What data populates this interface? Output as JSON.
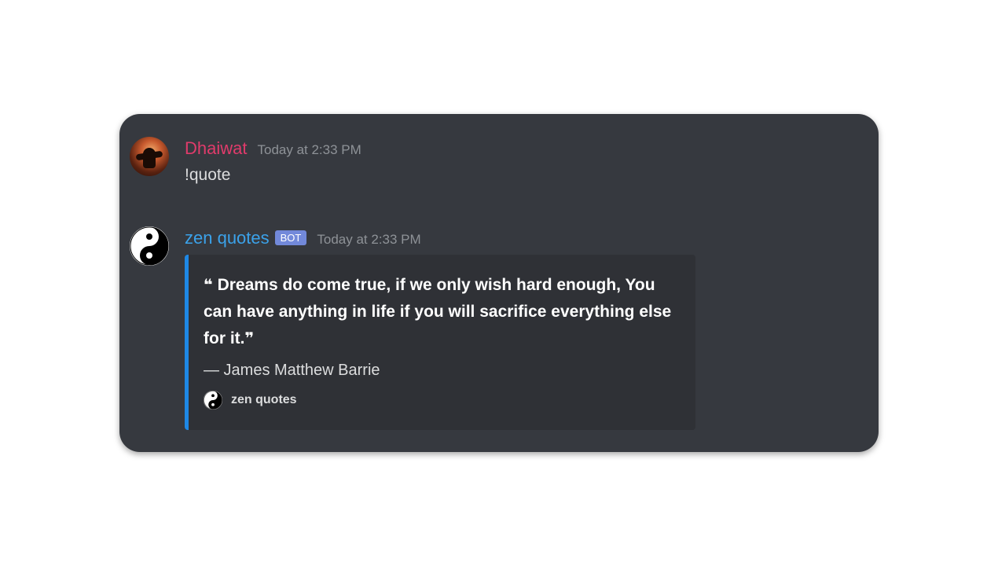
{
  "messages": [
    {
      "author": "Dhaiwat",
      "timestamp": "Today at 2:33 PM",
      "text": "!quote",
      "avatar_icon": "user-avatar",
      "name_color": "#e03b6b"
    },
    {
      "author": "zen quotes",
      "badge": "BOT",
      "timestamp": "Today at 2:33 PM",
      "avatar_icon": "yin-yang-icon",
      "name_color": "#3ba2ea",
      "embed": {
        "open_quote": "❝",
        "quote": "Dreams do come true, if we only wish hard enough, You can have anything in life if you will sacrifice everything else for it.",
        "close_quote": "❞",
        "author_line": "— James Matthew Barrie",
        "footer_icon": "yin-yang-icon",
        "footer_text": "zen quotes",
        "accent_color": "#1e88e5"
      }
    }
  ],
  "colors": {
    "card_background": "#36393f",
    "embed_background": "#2f3136",
    "badge_background": "#7289da"
  }
}
